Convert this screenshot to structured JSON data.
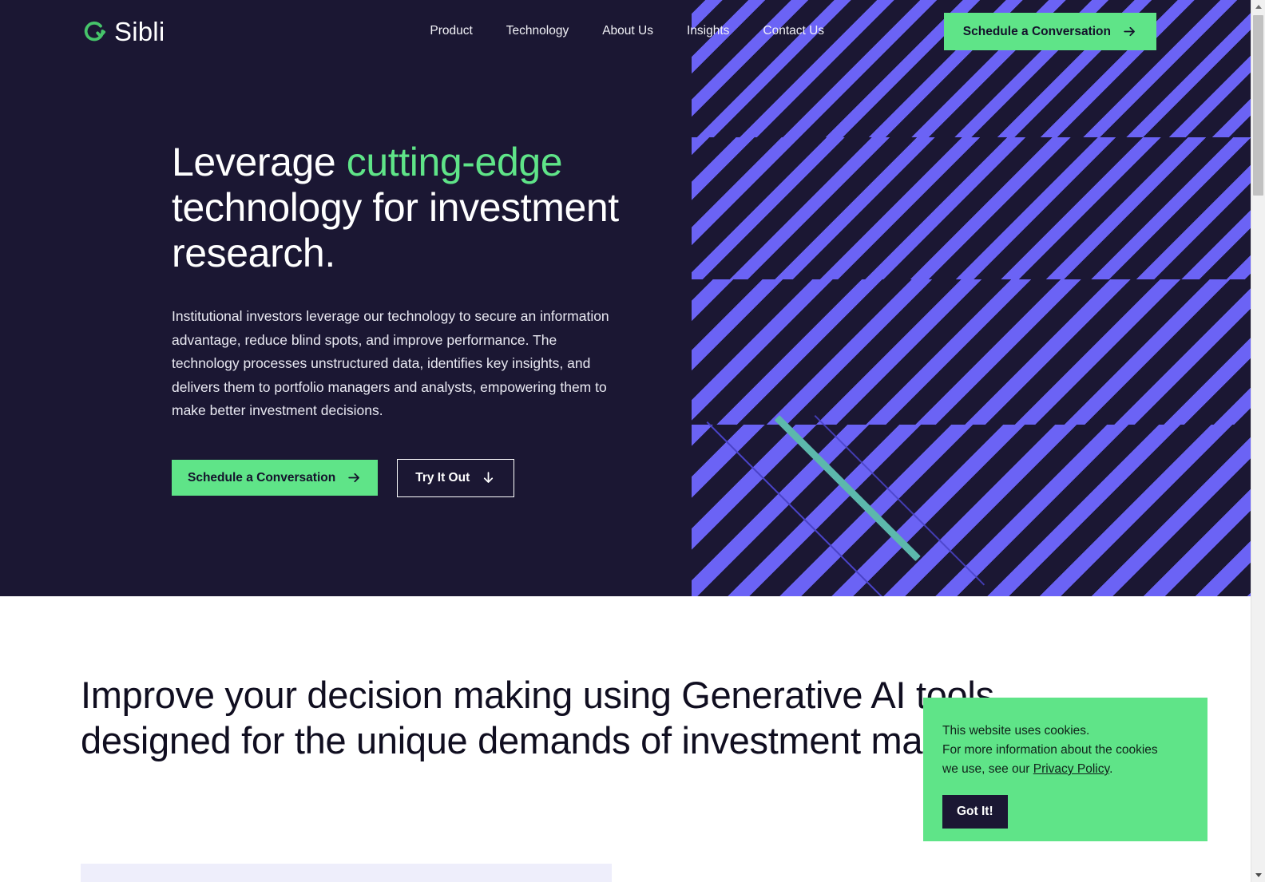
{
  "brand": {
    "name": "Sibli",
    "logo_icon": "sibli-circle-check-logo",
    "accent_green": "#5fe488",
    "dark_navy": "#1b1733",
    "stripe_purple": "#6b63f5",
    "stripe_teal": "#5cb8ac"
  },
  "header": {
    "nav": [
      {
        "label": "Product"
      },
      {
        "label": "Technology"
      },
      {
        "label": "About Us"
      },
      {
        "label": "Insights"
      },
      {
        "label": "Contact Us"
      }
    ],
    "cta": {
      "label": "Schedule a Conversation",
      "icon": "arrow-right-icon"
    }
  },
  "hero": {
    "title_part1": "Leverage ",
    "title_highlight": "cutting-edge",
    "title_part2": " technology for investment research.",
    "paragraph": "Institutional investors leverage our technology to secure an information advantage, reduce blind spots, and improve performance. The technology processes unstructured data, identifies key insights, and delivers them to portfolio managers and analysts, empowering them to make better investment decisions.",
    "primary_cta": {
      "label": "Schedule a Conversation",
      "icon": "arrow-right-icon"
    },
    "secondary_cta": {
      "label": "Try It Out",
      "icon": "arrow-down-icon"
    }
  },
  "section": {
    "heading": "Improve your decision making using Generative AI tools designed for the unique demands of investment management."
  },
  "cookie_banner": {
    "line1": "This website uses cookies.",
    "line2": "For more information about the cookies",
    "line3_prefix": "we use, see our ",
    "privacy_link": "Privacy Policy",
    "line3_suffix": ".",
    "accept_label": "Got It!"
  },
  "scrollbar": {
    "up_icon": "caret-up-icon",
    "down_icon": "caret-down-icon"
  }
}
